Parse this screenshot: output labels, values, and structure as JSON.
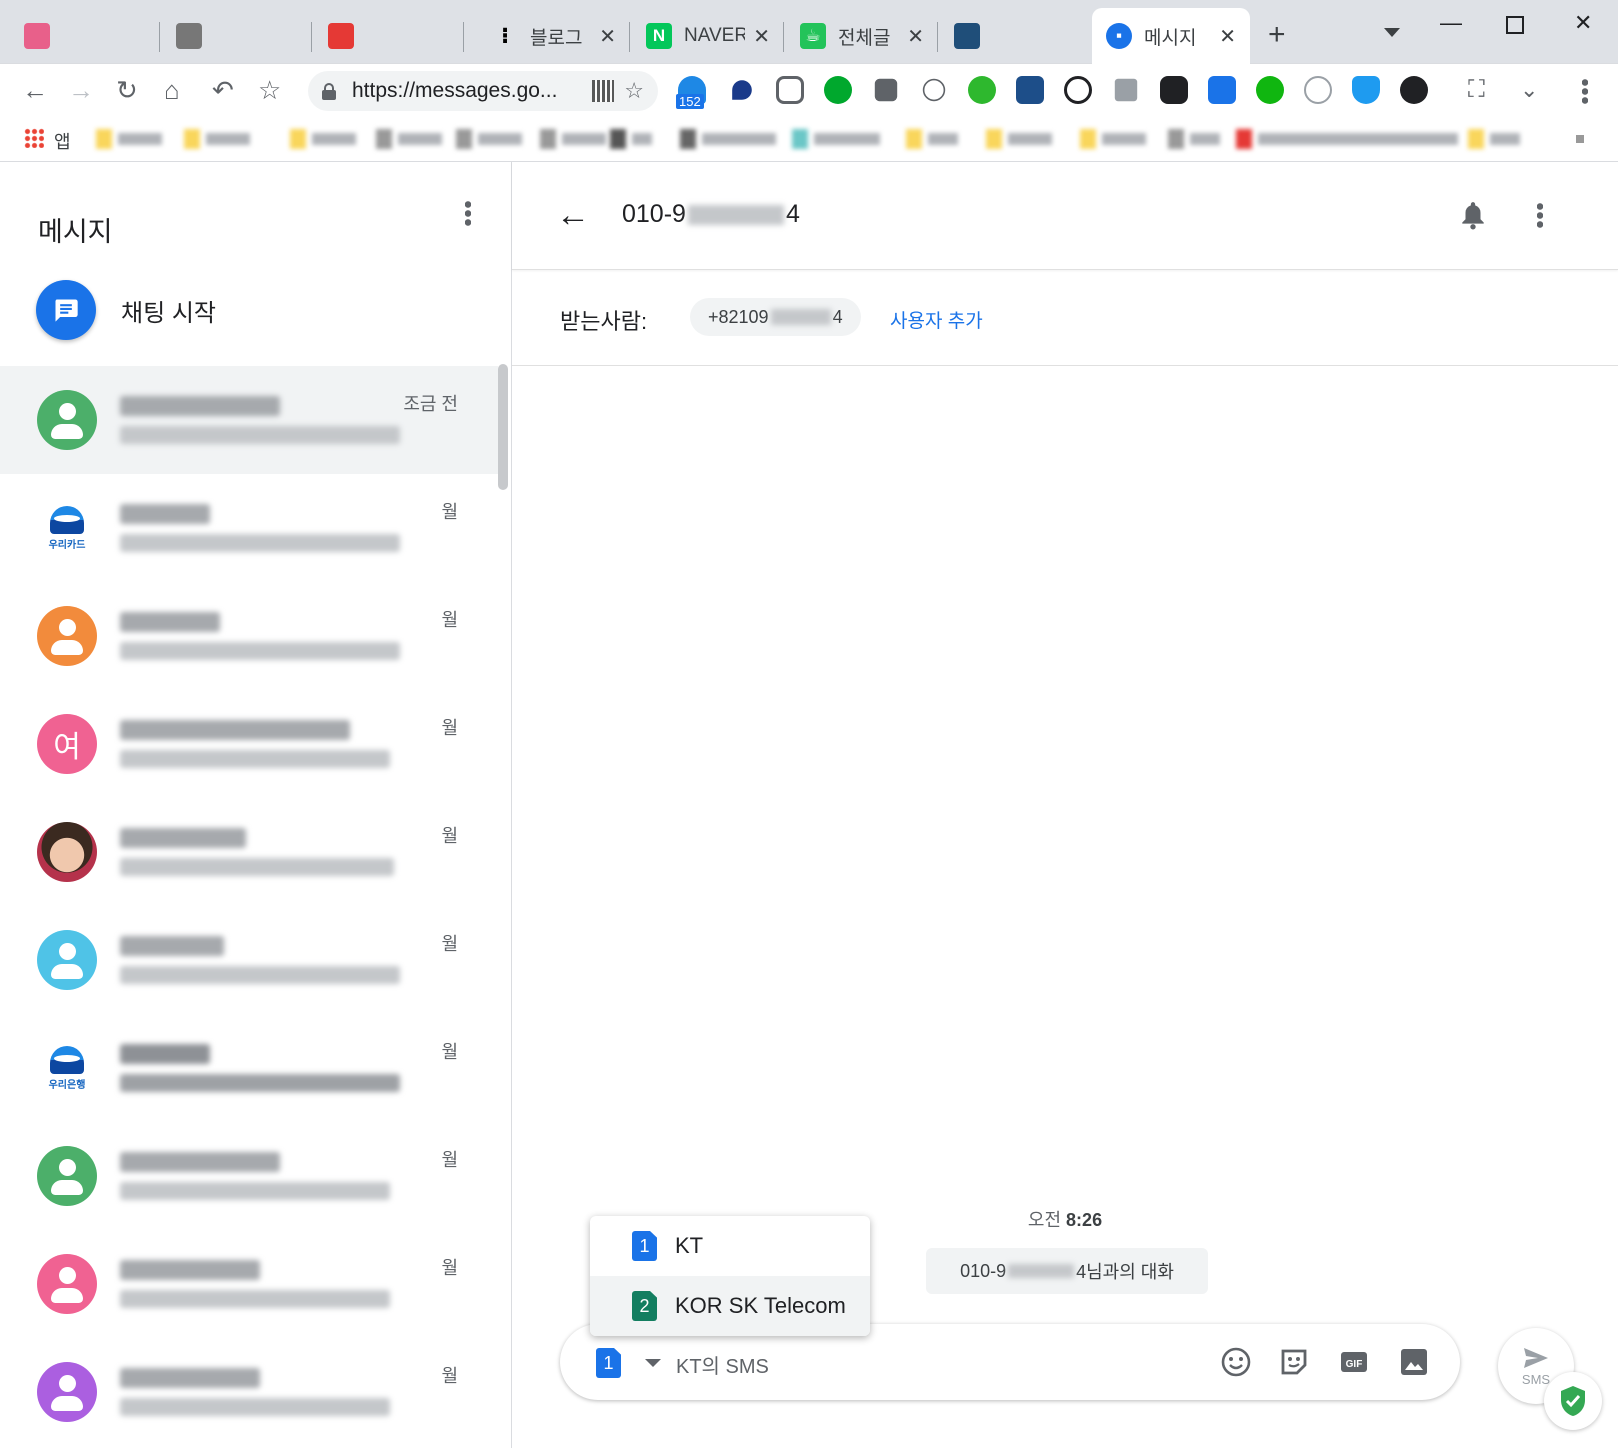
{
  "browser": {
    "tabs": [
      {
        "title": "",
        "favicon_color": "#e8608a",
        "blurred": true
      },
      {
        "title": "",
        "favicon_color": "#777777",
        "blurred": true
      },
      {
        "title": "",
        "favicon_color": "#e53935",
        "blurred": true
      },
      {
        "title": "블로그",
        "favicon_color": "#000000",
        "blurred": false
      },
      {
        "title": "NAVER",
        "favicon_color": "#03c75a",
        "favicon_text": "N",
        "blurred": false
      },
      {
        "title": "전체글",
        "favicon_color": "#23c35a",
        "blurred": false
      },
      {
        "title": "",
        "favicon_color": "#1f4e79",
        "blurred": true
      },
      {
        "title": "메시지",
        "favicon_color": "#1a73e8",
        "blurred": false,
        "active": true
      }
    ],
    "url": "https://messages.go...",
    "extension_badge": "152",
    "bookmarks_apps_label": "앱"
  },
  "sidebar": {
    "title": "메시지",
    "start_chat_label": "채팅 시작",
    "conversations": [
      {
        "time": "조금 전",
        "avatar": "person",
        "color": "#4caf6a",
        "selected": true
      },
      {
        "time": "월",
        "avatar": "logo",
        "logo_text": "우리카드"
      },
      {
        "time": "월",
        "avatar": "person",
        "color": "#f28b3c"
      },
      {
        "time": "월",
        "avatar": "letter",
        "letter": "여",
        "color": "#f06292"
      },
      {
        "time": "월",
        "avatar": "photo"
      },
      {
        "time": "월",
        "avatar": "person",
        "color": "#4fc3e7"
      },
      {
        "time": "월",
        "avatar": "logo",
        "logo_text": "우리은행"
      },
      {
        "time": "월",
        "avatar": "person",
        "color": "#4caf6a"
      },
      {
        "time": "월",
        "avatar": "person",
        "color": "#f06292"
      },
      {
        "time": "월",
        "avatar": "person",
        "color": "#ab5fe0"
      }
    ]
  },
  "conversation": {
    "title_prefix": "010-9",
    "title_suffix": "4",
    "recipient_label": "받는사람:",
    "recipient_prefix": "+82109",
    "recipient_suffix": "4",
    "add_user": "사용자 추가",
    "timestamp_prefix": "오전",
    "timestamp_time": "8:26",
    "note_prefix": "010-9",
    "note_suffix": "4님과의 대화"
  },
  "sim_menu": [
    {
      "num": "1",
      "label": "KT"
    },
    {
      "num": "2",
      "label": "KOR SK Telecom"
    }
  ],
  "compose": {
    "sim_num": "1",
    "placeholder": "KT의 SMS",
    "send_label": "SMS"
  },
  "colors": {
    "accent": "#1a73e8",
    "sim2": "#137e60"
  }
}
